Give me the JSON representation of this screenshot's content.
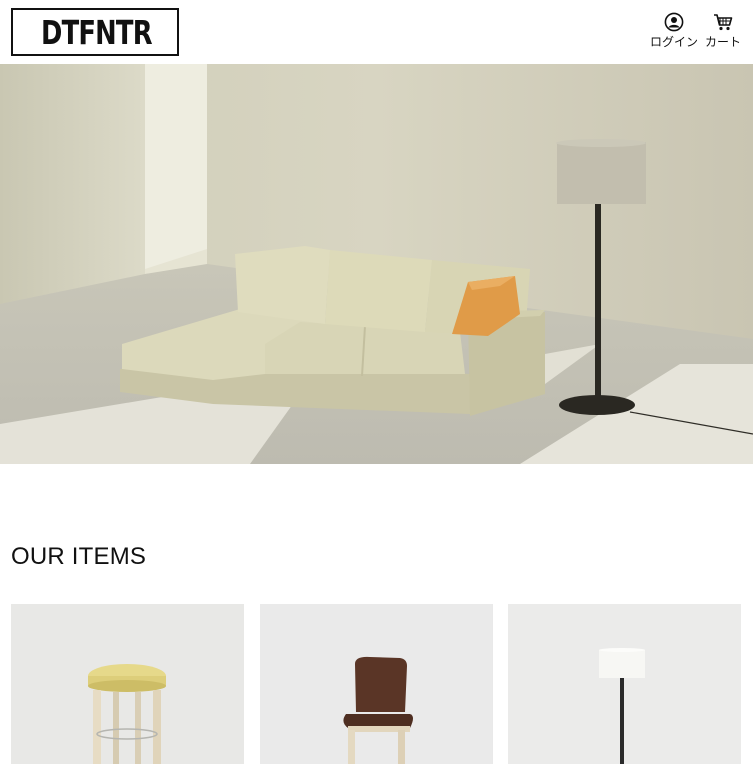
{
  "header": {
    "brand": "DTFNTR",
    "logo_icon": "armchair-icon",
    "login_label": "ログイン",
    "login_icon": "user-circle-icon",
    "cart_label": "カート",
    "cart_icon": "shopping-cart-icon"
  },
  "hero": {
    "image": "living-room-sofa-with-floor-lamp"
  },
  "items_section": {
    "title": "OUR ITEMS",
    "items": [
      {
        "image": "wooden-stool-yellow-seat"
      },
      {
        "image": "brown-leather-dining-chair"
      },
      {
        "image": "white-shade-floor-lamp"
      }
    ]
  },
  "colors": {
    "text": "#111111",
    "background": "#ffffff",
    "card_background": "#e9e9e9"
  }
}
